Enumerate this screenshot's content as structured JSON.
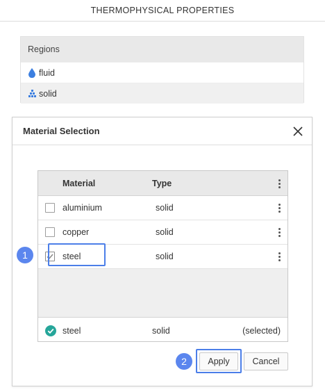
{
  "page": {
    "title": "THERMOPHYSICAL PROPERTIES"
  },
  "regions": {
    "header": "Regions",
    "items": [
      {
        "label": "fluid",
        "icon": "water-drop-icon"
      },
      {
        "label": "solid",
        "icon": "solid-blocks-icon"
      }
    ]
  },
  "dialog": {
    "title": "Material Selection",
    "columns": {
      "material": "Material",
      "type": "Type"
    },
    "rows": [
      {
        "material": "aluminium",
        "type": "solid",
        "checked": false
      },
      {
        "material": "copper",
        "type": "solid",
        "checked": false
      },
      {
        "material": "steel",
        "type": "solid",
        "checked": true
      }
    ],
    "footer": {
      "material": "steel",
      "type": "solid",
      "status": "(selected)"
    },
    "buttons": {
      "apply": "Apply",
      "cancel": "Cancel"
    },
    "step_badges": [
      "1",
      "2"
    ]
  },
  "colors": {
    "accent": "#4b7ee8",
    "badge": "#5b86ee",
    "check_ok": "#26a69a",
    "drop": "#3c7fe0"
  }
}
